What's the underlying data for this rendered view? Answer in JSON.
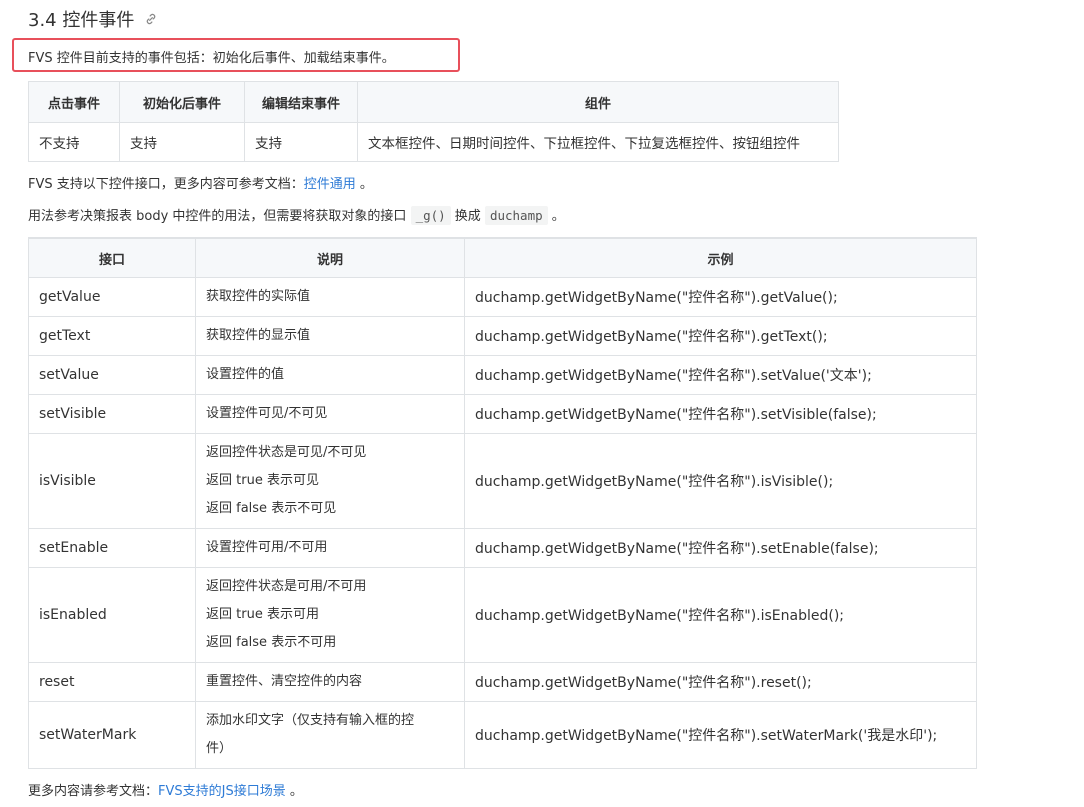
{
  "section": {
    "title": "3.4 控件事件",
    "intro": "FVS 控件目前支持的事件包括：初始化后事件、加载结束事件。"
  },
  "events_table": {
    "headers": [
      "点击事件",
      "初始化后事件",
      "编辑结束事件",
      "组件"
    ],
    "row": [
      "不支持",
      "支持",
      "支持",
      "文本框控件、日期时间控件、下拉框控件、下拉复选框控件、按钮组控件"
    ]
  },
  "para1": {
    "text": "FVS 支持以下控件接口，更多内容可参考文档：",
    "link": "控件通用",
    "end": " 。"
  },
  "para2": {
    "pre": "用法参考决策报表 body 中控件的用法，但需要将获取对象的接口 ",
    "code1": "_g()",
    "mid": " 换成 ",
    "code2": "duchamp",
    "end": " 。"
  },
  "api_table": {
    "headers": [
      "接口",
      "说明",
      "示例"
    ],
    "rows": [
      {
        "name": "getValue",
        "desc": [
          "获取控件的实际值"
        ],
        "example": "duchamp.getWidgetByName(\"控件名称\").getValue();"
      },
      {
        "name": "getText",
        "desc": [
          "获取控件的显示值"
        ],
        "example": "duchamp.getWidgetByName(\"控件名称\").getText();"
      },
      {
        "name": "setValue",
        "desc": [
          "设置控件的值"
        ],
        "example": "duchamp.getWidgetByName(\"控件名称\").setValue('文本');"
      },
      {
        "name": "setVisible",
        "desc": [
          "设置控件可见/不可见"
        ],
        "example": "duchamp.getWidgetByName(\"控件名称\").setVisible(false);"
      },
      {
        "name": "isVisible",
        "desc": [
          "返回控件状态是可见/不可见",
          "返回 true 表示可见",
          "返回 false 表示不可见"
        ],
        "example": "duchamp.getWidgetByName(\"控件名称\").isVisible();"
      },
      {
        "name": "setEnable",
        "desc": [
          "设置控件可用/不可用"
        ],
        "example": "duchamp.getWidgetByName(\"控件名称\").setEnable(false);"
      },
      {
        "name": "isEnabled",
        "desc": [
          "返回控件状态是可用/不可用",
          "返回 true 表示可用",
          "返回 false 表示不可用"
        ],
        "example": "duchamp.getWidgetByName(\"控件名称\").isEnabled();"
      },
      {
        "name": "reset",
        "desc": [
          "重置控件、清空控件的内容"
        ],
        "example": "duchamp.getWidgetByName(\"控件名称\").reset();"
      },
      {
        "name": "setWaterMark",
        "desc": [
          "添加水印文字（仅支持有输入框的控",
          "件）"
        ],
        "example": "duchamp.getWidgetByName(\"控件名称\").setWaterMark('我是水印');"
      }
    ]
  },
  "footer": {
    "text": "更多内容请参考文档：",
    "link": "FVS支持的JS接口场景",
    "end": " 。"
  }
}
